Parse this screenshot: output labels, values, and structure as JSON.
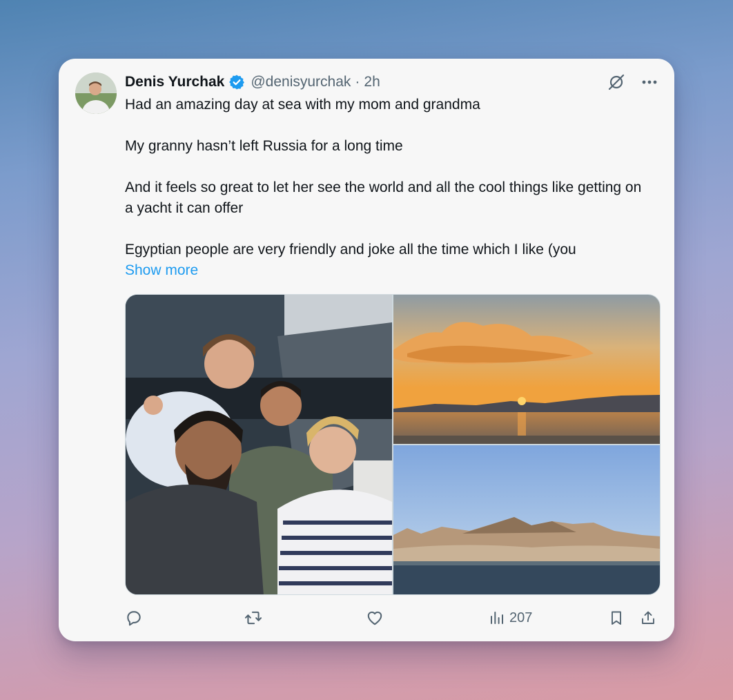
{
  "tweet": {
    "author_name": "Denis Yurchak",
    "handle": "@denisyurchak",
    "separator": "·",
    "time": "2h",
    "paragraphs": [
      "Had an amazing day at sea with my mom and grandma",
      "My granny hasn’t left Russia for a long time",
      "And it feels so great to let her see the world and all the cool things like getting on a yacht it can offer",
      "Egyptian people are very friendly and joke all the time which I like (you"
    ],
    "show_more": "Show more",
    "views": "207"
  },
  "media": [
    {
      "subject": "group-selfie-on-yacht"
    },
    {
      "subject": "sunset-over-sea"
    },
    {
      "subject": "desert-mountains-by-sea"
    }
  ],
  "icons": {
    "verified": "verified-badge-icon",
    "grok": "grok-icon",
    "more": "more-icon",
    "reply": "reply-icon",
    "retweet": "retweet-icon",
    "like": "like-icon",
    "views": "views-icon",
    "bookmark": "bookmark-icon",
    "share": "share-icon"
  },
  "colors": {
    "accent": "#1d9bf0",
    "text": "#0f1419",
    "muted": "#536471",
    "card": "#f7f7f7"
  }
}
